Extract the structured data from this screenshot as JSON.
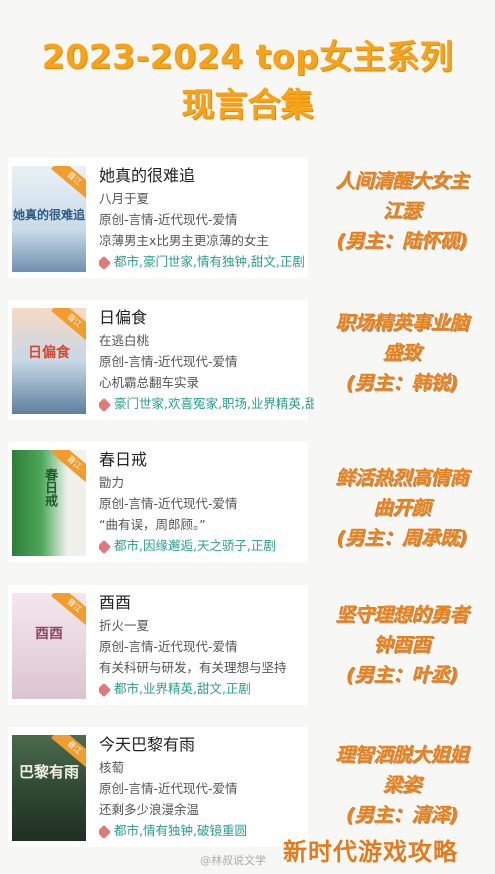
{
  "header": {
    "line1": "2023-2024 top女主系列",
    "line2": "现言合集"
  },
  "books": [
    {
      "title": "她真的很难追",
      "author": "八月于夏",
      "category": "原创-言情-近代现代-爱情",
      "blurb": "凉薄男主x比男主更凉薄的女主",
      "tags": "都市,豪门世家,情有独钟,甜文,正剧",
      "cover_text": "她真的很难追",
      "badge": "晋江",
      "note": [
        "人间清醒大女主",
        "江瑟",
        "(男主：陆怀砚)"
      ]
    },
    {
      "title": "日偏食",
      "author": "在逃白桃",
      "category": "原创-言情-近代现代-爱情",
      "blurb": "心机霸总翻车实录",
      "tags": "豪门世家,欢喜冤家,职场,业界精英,甜文,正剧",
      "cover_text": "日偏食",
      "badge": "晋江",
      "note": [
        "职场精英事业脑",
        "盛致",
        "(男主：韩锐)"
      ]
    },
    {
      "title": "春日戒",
      "author": "勖力",
      "category": "原创-言情-近代现代-爱情",
      "blurb": "“曲有误，周郎顾。”",
      "tags": "都市,因缘邂逅,天之骄子,正剧",
      "cover_text": "春日戒",
      "badge": "晋江",
      "note": [
        "鲜活热烈高情商",
        "曲开颜",
        "(男主：周承既)"
      ]
    },
    {
      "title": "酉酉",
      "author": "折火一夏",
      "category": "原创-言情-近代现代-爱情",
      "blurb": "有关科研与研发，有关理想与坚持",
      "tags": "都市,业界精英,甜文,正剧",
      "cover_text": "酉酉",
      "badge": "晋江",
      "note": [
        "坚守理想的勇者",
        "钟酉酉",
        "(男主：叶丞)"
      ]
    },
    {
      "title": "今天巴黎有雨",
      "author": "核萄",
      "category": "原创-言情-近代现代-爱情",
      "blurb": "还剩多少浪漫余温",
      "tags": "都市,情有独钟,破镜重圆",
      "cover_text": "巴黎有雨",
      "badge": "晋江",
      "note": [
        "理智洒脱大姐姐",
        "梁姿",
        "(男主：清泽)"
      ]
    }
  ],
  "footer": {
    "watermark": "@林叔说文学",
    "brand": "新时代游戏攻略"
  },
  "colors": {
    "accent": "#f6a21a",
    "note": "#e5801b",
    "tag": "#2a9d8f"
  }
}
